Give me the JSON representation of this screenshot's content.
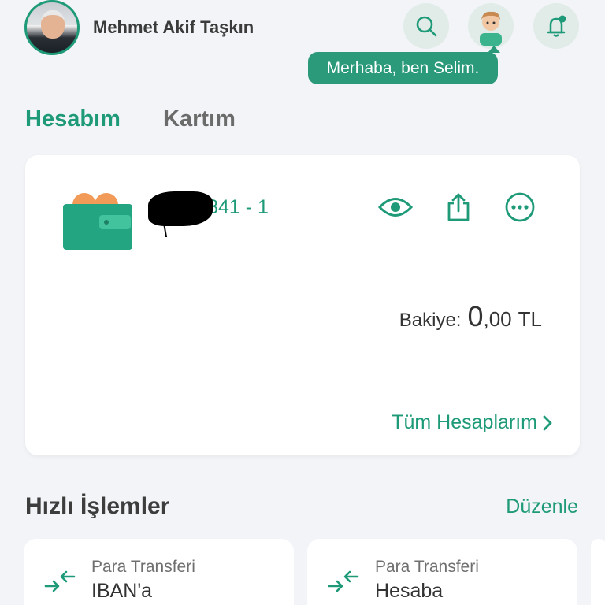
{
  "header": {
    "user_name": "Mehmet Akif Taşkın",
    "assistant_greeting": "Merhaba, ben Selim.",
    "search_icon": "search-icon",
    "assistant_icon": "assistant-avatar",
    "notification_icon": "bell-icon"
  },
  "tabs": [
    {
      "label": "Hesabım",
      "active": true
    },
    {
      "label": "Kartım",
      "active": false
    }
  ],
  "account_card": {
    "account_number": "9■■■0841 - 1",
    "balance_label": "Bakiye:",
    "balance_integer": "0",
    "balance_decimal": ",00",
    "balance_currency": "TL",
    "all_accounts_label": "Tüm Hesaplarım",
    "icons": [
      "eye-icon",
      "share-icon",
      "more-icon"
    ]
  },
  "quick_actions": {
    "title": "Hızlı İşlemler",
    "edit_label": "Düzenle",
    "items": [
      {
        "subtitle": "Para Transferi",
        "title": "IBAN'a"
      },
      {
        "subtitle": "Para Transferi",
        "title": "Hesaba"
      }
    ]
  },
  "colors": {
    "accent": "#1e9a78",
    "background": "#f2f4f7",
    "tooltip": "#2b9a7a"
  }
}
